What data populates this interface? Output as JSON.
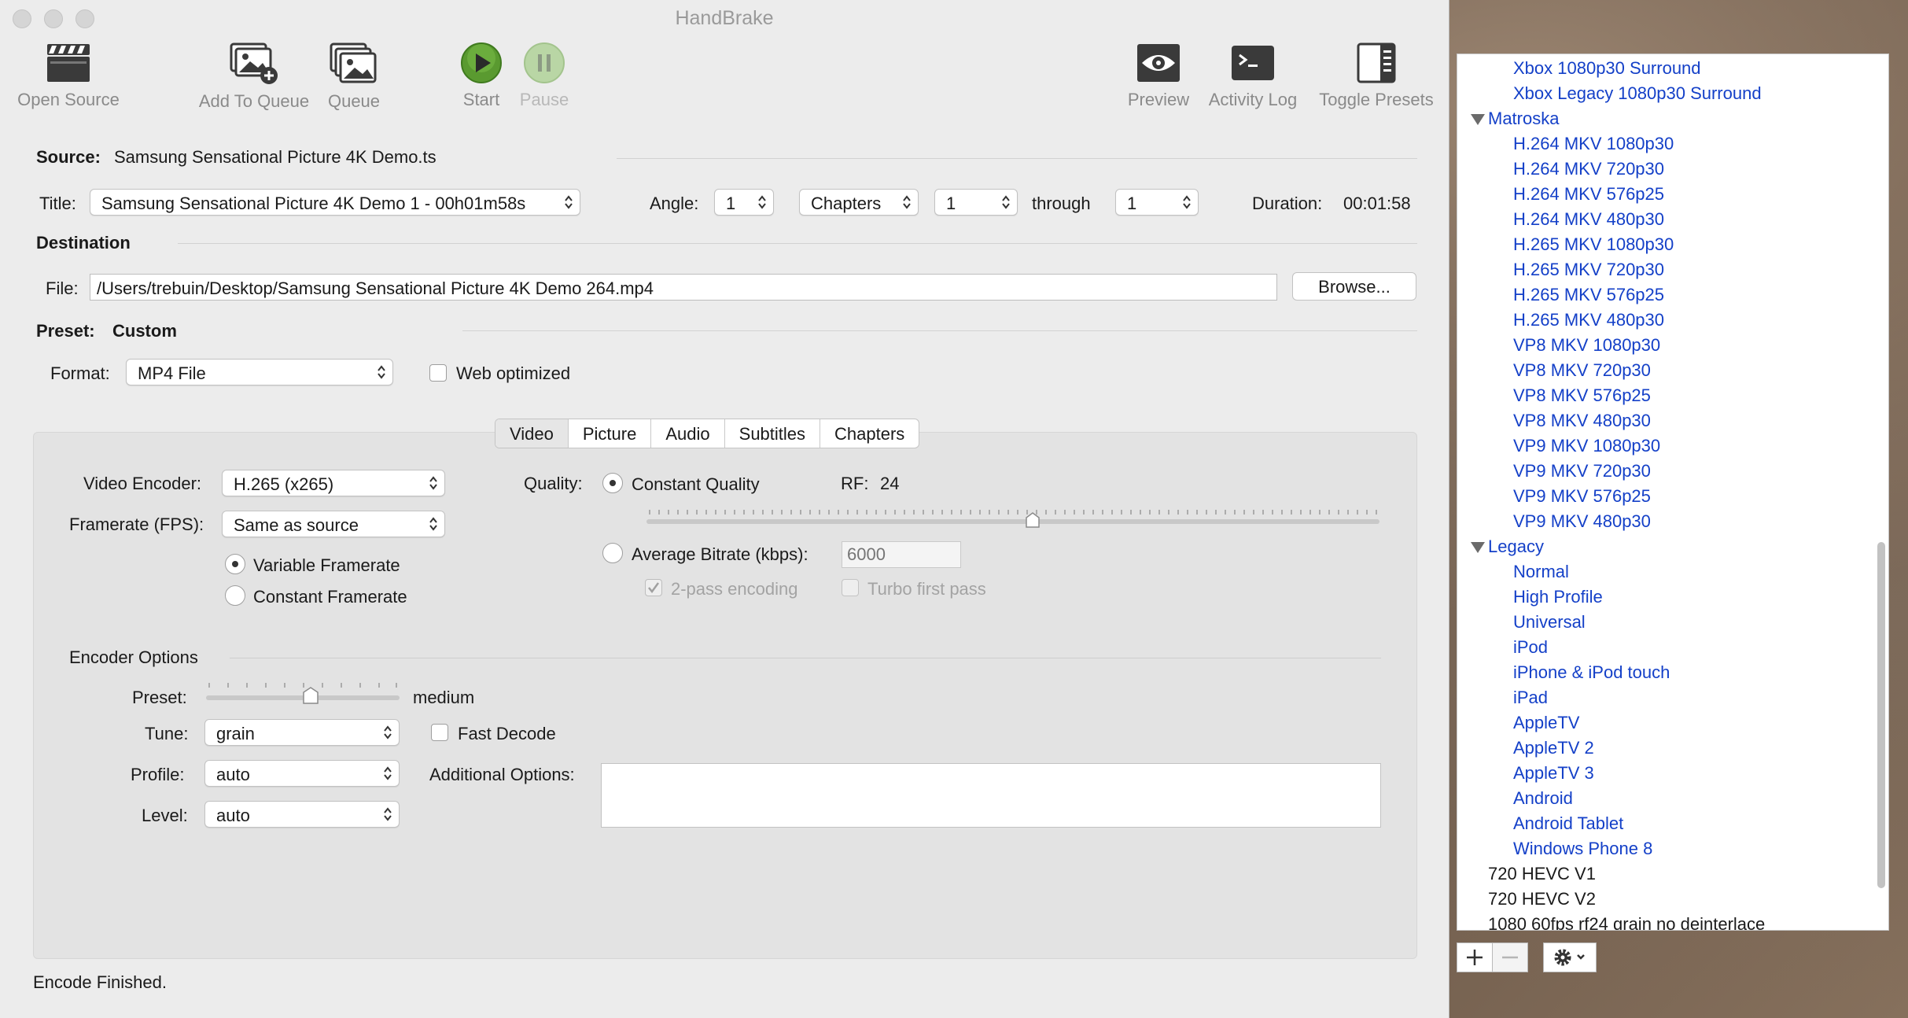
{
  "window": {
    "title": "HandBrake"
  },
  "toolbar": {
    "open_source": "Open Source",
    "add_to_queue": "Add To Queue",
    "queue": "Queue",
    "start": "Start",
    "pause": "Pause",
    "preview": "Preview",
    "activity_log": "Activity Log",
    "toggle_presets": "Toggle Presets"
  },
  "source": {
    "label": "Source:",
    "value": "Samsung Sensational Picture 4K Demo.ts"
  },
  "title_row": {
    "title_label": "Title:",
    "title_value": "Samsung Sensational Picture 4K Demo 1 - 00h01m58s",
    "angle_label": "Angle:",
    "angle_value": "1",
    "range_type": "Chapters",
    "range_start": "1",
    "through_label": "through",
    "range_end": "1",
    "duration_label": "Duration:",
    "duration_value": "00:01:58"
  },
  "destination": {
    "heading": "Destination",
    "file_label": "File:",
    "file_value": "/Users/trebuin/Desktop/Samsung Sensational Picture 4K Demo 264.mp4",
    "browse": "Browse..."
  },
  "preset": {
    "label": "Preset:",
    "value": "Custom",
    "format_label": "Format:",
    "format_value": "MP4 File",
    "web_optimized": "Web optimized"
  },
  "tabs": [
    "Video",
    "Picture",
    "Audio",
    "Subtitles",
    "Chapters"
  ],
  "video": {
    "encoder_label": "Video Encoder:",
    "encoder_value": "H.265 (x265)",
    "framerate_label": "Framerate (FPS):",
    "framerate_value": "Same as source",
    "variable_framerate": "Variable Framerate",
    "constant_framerate": "Constant Framerate",
    "quality_label": "Quality:",
    "constant_quality": "Constant Quality",
    "rf_label": "RF:",
    "rf_value": "24",
    "average_bitrate": "Average Bitrate (kbps):",
    "bitrate_placeholder": "6000",
    "two_pass": "2-pass encoding",
    "turbo": "Turbo first pass"
  },
  "encoder_options": {
    "heading": "Encoder Options",
    "preset_label": "Preset:",
    "preset_value": "medium",
    "tune_label": "Tune:",
    "tune_value": "grain",
    "fast_decode": "Fast Decode",
    "profile_label": "Profile:",
    "profile_value": "auto",
    "additional_label": "Additional Options:",
    "level_label": "Level:",
    "level_value": "auto"
  },
  "status": "Encode Finished.",
  "presets_panel": {
    "xbox_items": [
      "Xbox 1080p30 Surround",
      "Xbox Legacy 1080p30 Surround"
    ],
    "matroska_group": "Matroska",
    "matroska_items": [
      "H.264 MKV 1080p30",
      "H.264 MKV 720p30",
      "H.264 MKV 576p25",
      "H.264 MKV 480p30",
      "H.265 MKV 1080p30",
      "H.265 MKV 720p30",
      "H.265 MKV 576p25",
      "H.265 MKV 480p30",
      "VP8 MKV 1080p30",
      "VP8 MKV 720p30",
      "VP8 MKV 576p25",
      "VP8 MKV 480p30",
      "VP9 MKV 1080p30",
      "VP9 MKV 720p30",
      "VP9 MKV 576p25",
      "VP9 MKV 480p30"
    ],
    "legacy_group": "Legacy",
    "legacy_items": [
      "Normal",
      "High Profile",
      "Universal",
      "iPod",
      "iPhone & iPod touch",
      "iPad",
      "AppleTV",
      "AppleTV 2",
      "AppleTV 3",
      "Android",
      "Android Tablet",
      "Windows Phone 8"
    ],
    "custom_items": [
      "720 HEVC V1",
      "720 HEVC V2",
      "1080 60fps rf24 grain no deinterlace"
    ]
  }
}
